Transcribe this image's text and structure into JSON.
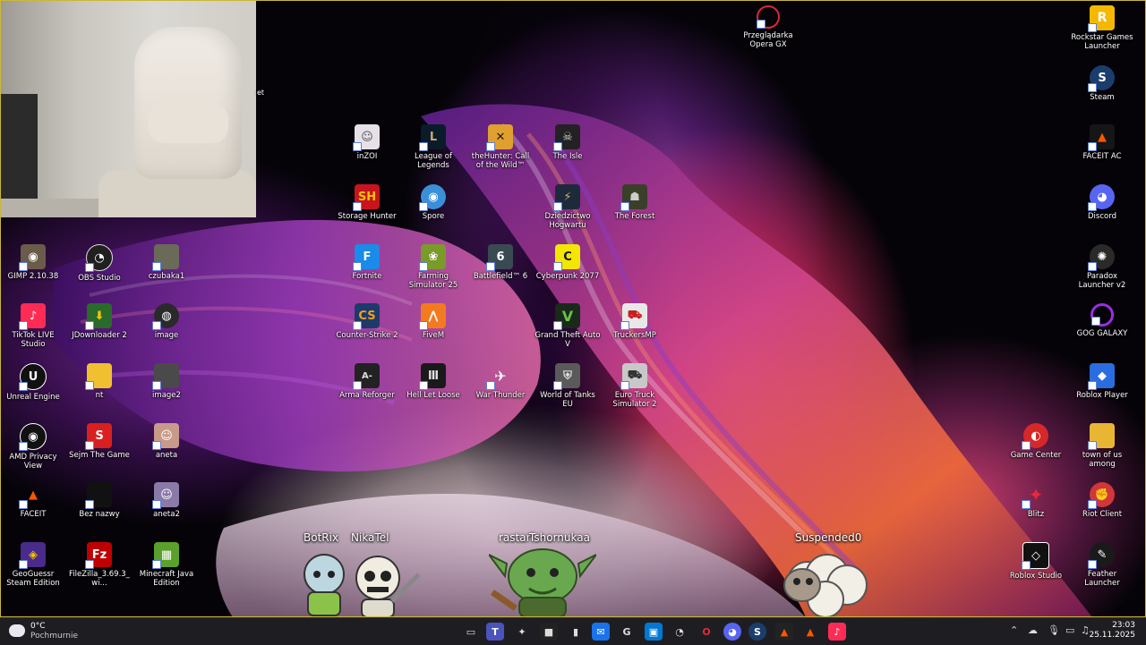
{
  "desktop_icons": {
    "opera_gx": "Przeglądarka Opera GX",
    "rockstar": "Rockstar Games Launcher",
    "steam": "Steam",
    "faceit_ac": "FACEIT AC",
    "discord": "Discord",
    "paradox": "Paradox Launcher v2",
    "gog": "GOG GALAXY",
    "roblox_player": "Roblox Player",
    "game_center": "Game Center",
    "town_of_us": "town of us among",
    "blitz": "Blitz",
    "riot": "Riot Client",
    "roblox_studio": "Roblox Studio",
    "feather": "Feather Launcher",
    "inzoi": "inZOI",
    "lol": "League of Legends",
    "thehunter": "theHunter: Call of the Wild™",
    "theisle": "The Isle",
    "storage_hunter": "Storage Hunter",
    "spore": "Spore",
    "hogwarts": "Dziedzictwo Hogwartu",
    "theforest": "The Forest",
    "fortnite": "Fortnite",
    "farming": "Farming Simulator 25",
    "battlefield": "Battlefield™ 6",
    "cyberpunk": "Cyberpunk 2077",
    "cs2": "Counter-Strike 2",
    "fivem": "FiveM",
    "gta5": "Grand Theft Auto V",
    "truckersmp": "TruckersMP",
    "arma": "Arma Reforger",
    "hell_let_loose": "Hell Let Loose",
    "war_thunder": "War Thunder",
    "wot": "World of Tanks EU",
    "ets2": "Euro Truck Simulator 2",
    "gimp": "GIMP 2.10.38",
    "obs": "OBS Studio",
    "czubaka": "czubaka1",
    "tiktok": "TikTok LIVE Studio",
    "jdownloader": "JDownloader 2",
    "image": "image",
    "unreal": "Unreal Engine",
    "nt": "nt",
    "image2": "image2",
    "amd": "AMD Privacy View",
    "sejm": "Sejm The Game",
    "aneta": "aneta",
    "faceit": "FACEIT",
    "bez_nazwy": "Bez nazwy",
    "aneta2": "aneta2",
    "geoguessr": "GeoGuessr Steam Edition",
    "filezilla": "FileZilla_3.69.3_wi...",
    "minecraft": "Minecraft Java Edition"
  },
  "stream_overlay": {
    "viewer1": "BotRix",
    "viewer2": "NikaTel",
    "viewer3": "rastar",
    "viewer4": "Tshornukaa",
    "viewer5": "Suspended0"
  },
  "webcam_fragment": "et",
  "taskbar": {
    "weather_temp": "0°C",
    "weather_cond": "Pochmurnie",
    "time": "23:03",
    "date": "25.11.2025"
  }
}
